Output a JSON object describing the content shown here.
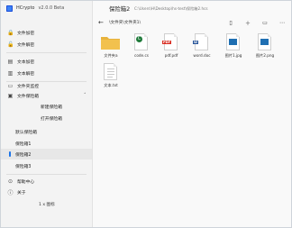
{
  "app": {
    "title": "HCrypto",
    "version": "v2.0.0 Beta"
  },
  "window_controls": {
    "minimize": "—",
    "maximize": "□",
    "close": "✕"
  },
  "sidebar": {
    "items": [
      {
        "label": "文件加密",
        "icon": "lock-icon"
      },
      {
        "label": "文件解密",
        "icon": "unlock-icon"
      },
      {
        "label": "文本加密",
        "icon": "text-lock-icon"
      },
      {
        "label": "文本解密",
        "icon": "text-unlock-icon"
      },
      {
        "label": "文件夹监控",
        "icon": "folder-watch-icon"
      },
      {
        "label": "文件保险箱",
        "icon": "safe-icon",
        "expanded": true
      }
    ],
    "sub_items": [
      "新建保险箱",
      "打开保险箱"
    ],
    "vaults": [
      "默认保险箱",
      "保险箱1",
      "保险箱2",
      "保险箱3"
    ],
    "active_vault_index": 2,
    "bottom_items": [
      {
        "label": "帮助中心",
        "icon": "help-icon"
      },
      {
        "label": "关于",
        "icon": "info-icon"
      }
    ],
    "footer": "1 x 图标"
  },
  "main": {
    "title": "保险箱2",
    "path": "C:\\Users\\H\\Desktop\\hs-test\\保险箱2.hcs",
    "breadcrumb": "\\文件夹\\文件夹1\\",
    "toolbar_icons": [
      "new-file-icon",
      "add-icon",
      "open-folder-icon",
      "more-icon"
    ]
  },
  "files": [
    {
      "name": "文件夹a",
      "type": "folder"
    },
    {
      "name": "code.cs",
      "type": "cs"
    },
    {
      "name": "pdf.pdf",
      "type": "pdf"
    },
    {
      "name": "word.doc",
      "type": "doc"
    },
    {
      "name": "图片1.jpg",
      "type": "jpg"
    },
    {
      "name": "图片2.png",
      "type": "png"
    },
    {
      "name": "文本.txt",
      "type": "txt"
    }
  ],
  "colors": {
    "accent": "#1a73e8",
    "folder": "#f2c14e",
    "pdf": "#d93025",
    "doc": "#2b579a",
    "img": "#1f6fb2",
    "cs": "#1f7a3a"
  }
}
